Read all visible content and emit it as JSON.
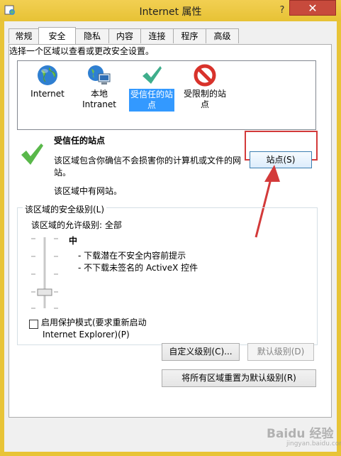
{
  "window": {
    "title": "Internet 属性",
    "help": "?",
    "close": "✕"
  },
  "tabs": [
    {
      "label": "常规"
    },
    {
      "label": "安全"
    },
    {
      "label": "隐私"
    },
    {
      "label": "内容"
    },
    {
      "label": "连接"
    },
    {
      "label": "程序"
    },
    {
      "label": "高级"
    }
  ],
  "active_tab": "安全",
  "security": {
    "instruction": "选择一个区域以查看或更改安全设置。",
    "zones": [
      {
        "line1": "Internet",
        "line2": "",
        "icon": "globe-icon"
      },
      {
        "line1": "本地",
        "line2": "Intranet",
        "icon": "intranet-icon"
      },
      {
        "line1": "受信任的站",
        "line2": "点",
        "icon": "checkmark-icon"
      },
      {
        "line1": "受限制的站",
        "line2": "点",
        "icon": "restricted-icon"
      }
    ],
    "selected_zone": "受信任的站点",
    "zone_heading": "受信任的站点",
    "zone_description": "该区域包含你确信不会损害你的计算机或文件的网站。",
    "zone_note": "该区域中有网站。",
    "sites_button": "站点(S)",
    "level_group_title": "该区域的安全级别(L)",
    "allowed_levels": "该区域的允许级别: 全部",
    "level_name": "中",
    "level_bullets": [
      "- 下载潜在不安全内容前提示",
      "- 不下载未签名的 ActiveX 控件"
    ],
    "protected_mode_line1": "启用保护模式(要求重新启动",
    "protected_mode_line2": "Internet Explorer)(P)",
    "protected_mode_checked": false,
    "custom_level_button": "自定义级别(C)...",
    "default_level_button": "默认级别(D)",
    "reset_all_button": "将所有区域重置为默认级别(R)"
  },
  "colors": {
    "titlebar": "#e8c437",
    "close": "#c74a3c",
    "highlight": "#d33a3a",
    "selection": "#3399ff"
  },
  "watermark": {
    "text": "Baidu 经验",
    "url": "jingyan.baidu.com"
  }
}
